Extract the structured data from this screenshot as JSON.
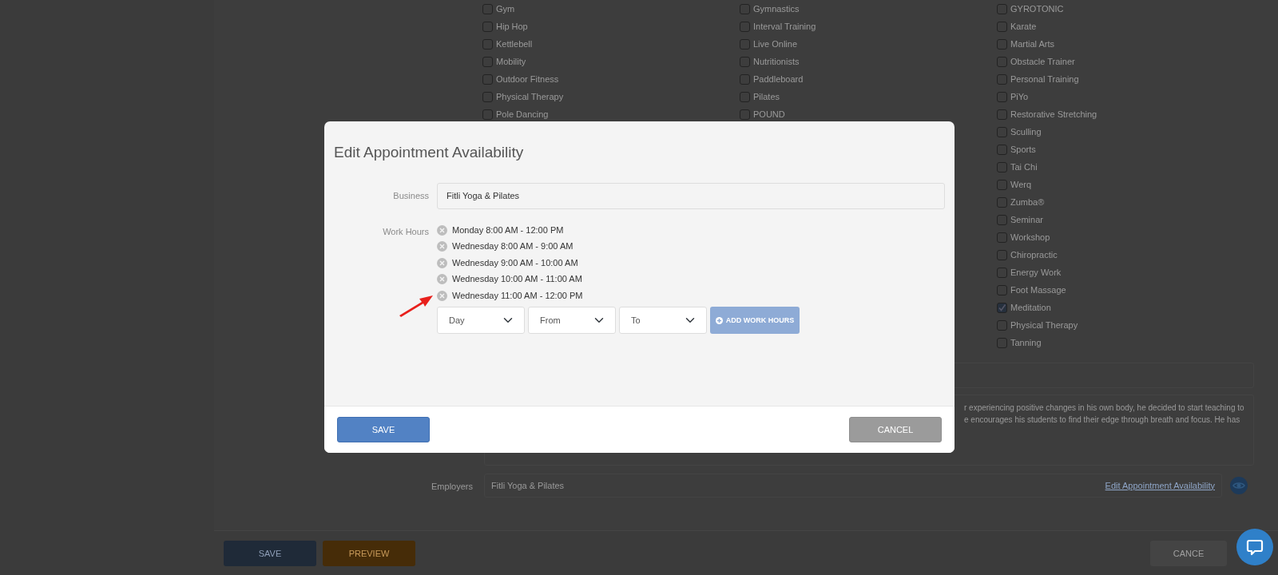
{
  "background": {
    "categories": [
      [
        {
          "label": "Gym",
          "checked": false
        },
        {
          "label": "Hip Hop",
          "checked": false
        },
        {
          "label": "Kettlebell",
          "checked": false
        },
        {
          "label": "Mobility",
          "checked": false
        },
        {
          "label": "Outdoor Fitness",
          "checked": false
        },
        {
          "label": "Physical Therapy",
          "checked": false
        },
        {
          "label": "Pole Dancing",
          "checked": false
        }
      ],
      [
        {
          "label": "Gymnastics",
          "checked": false
        },
        {
          "label": "Interval Training",
          "checked": false
        },
        {
          "label": "Live Online",
          "checked": false
        },
        {
          "label": "Nutritionists",
          "checked": false
        },
        {
          "label": "Paddleboard",
          "checked": false
        },
        {
          "label": "Pilates",
          "checked": false
        },
        {
          "label": "POUND",
          "checked": false
        }
      ],
      [
        {
          "label": "GYROTONIC",
          "checked": false
        },
        {
          "label": "Karate",
          "checked": false
        },
        {
          "label": "Martial Arts",
          "checked": false
        },
        {
          "label": "Obstacle Trainer",
          "checked": false
        },
        {
          "label": "Personal Training",
          "checked": false
        },
        {
          "label": "PiYo",
          "checked": false
        },
        {
          "label": "Restorative Stretching",
          "checked": false
        },
        {
          "label": "Sculling",
          "checked": false
        },
        {
          "label": "Sports",
          "checked": false
        },
        {
          "label": "Tai Chi",
          "checked": false
        },
        {
          "label": "Werq",
          "checked": false
        },
        {
          "label": "Zumba®",
          "checked": false
        },
        {
          "label": "Seminar",
          "checked": false
        },
        {
          "label": "Workshop",
          "checked": false
        },
        {
          "label": "Chiropractic",
          "checked": false
        },
        {
          "label": "Energy Work",
          "checked": false
        },
        {
          "label": "Foot Massage",
          "checked": false
        },
        {
          "label": "Meditation",
          "checked": true
        },
        {
          "label": "Physical Therapy",
          "checked": false
        },
        {
          "label": "Tanning",
          "checked": false
        }
      ]
    ],
    "bio_lines": [
      "r experiencing positive changes in his own body, he decided to start teaching to",
      "e encourages his students to find their edge through breath and focus. He has"
    ],
    "employers": {
      "label": "Employers",
      "value": "Fitli Yoga & Pilates",
      "link": "Edit Appointment Availability"
    },
    "buttons": [
      {
        "label": "SAVE",
        "kind": "primary"
      },
      {
        "label": "PREVIEW",
        "kind": "warning"
      },
      {
        "label": "CANCE",
        "kind": "secondary"
      }
    ]
  },
  "modal": {
    "title": "Edit Appointment Availability",
    "business": {
      "label": "Business",
      "value": "Fitli Yoga & Pilates"
    },
    "work_hours": {
      "label": "Work Hours",
      "entries": [
        "Monday 8:00 AM - 12:00 PM",
        "Wednesday 8:00 AM - 9:00 AM",
        "Wednesday 9:00 AM - 10:00 AM",
        "Wednesday 10:00 AM - 11:00 AM",
        "Wednesday 11:00 AM - 12:00 PM"
      ]
    },
    "selects": [
      {
        "placeholder": "Day"
      },
      {
        "placeholder": "From"
      },
      {
        "placeholder": "To"
      }
    ],
    "add_button": {
      "label": "ADD WORK HOURS",
      "disabled": true
    },
    "buttons": [
      {
        "label": "SAVE",
        "kind": "primary"
      },
      {
        "label": "CANCEL",
        "kind": "secondary"
      }
    ]
  }
}
